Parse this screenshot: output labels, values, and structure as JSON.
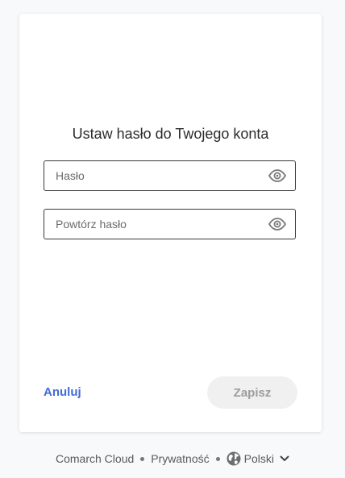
{
  "form": {
    "title": "Ustaw hasło do Twojego konta",
    "password_placeholder": "Hasło",
    "password_value": "",
    "repeat_placeholder": "Powtórz hasło",
    "repeat_value": "",
    "show_password_icon": "eye-icon"
  },
  "actions": {
    "cancel_label": "Anuluj",
    "save_label": "Zapisz"
  },
  "footer": {
    "brand_link": "Comarch Cloud",
    "privacy_link": "Prywatność",
    "language": "Polski",
    "language_icon": "globe-icon",
    "dropdown_icon": "chevron-down-icon"
  },
  "colors": {
    "link_accent": "#3f6ad8",
    "disabled_button_bg": "#f0f0f0",
    "disabled_button_text": "#9d9d9d",
    "page_bg": "#f8f9fb"
  }
}
